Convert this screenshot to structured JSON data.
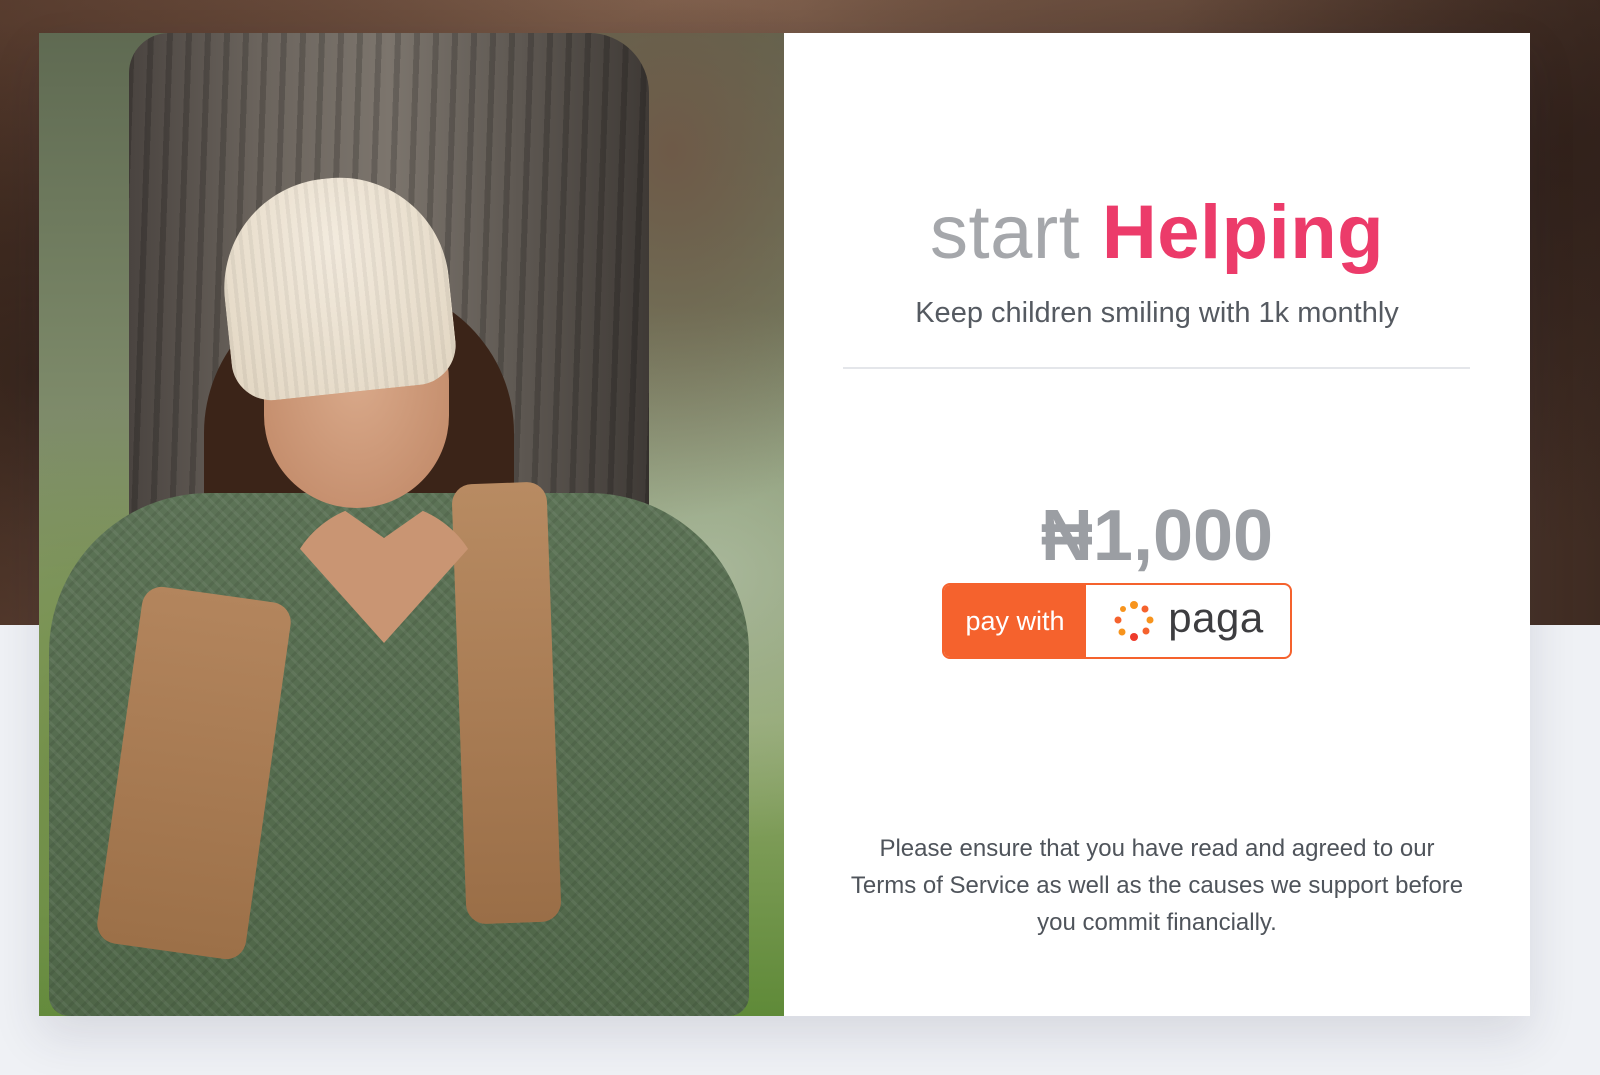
{
  "hero": {
    "image_alt": "Smiling girl in knit hat making heart shape with hands in front of tree"
  },
  "heading": {
    "light_text": "start",
    "bold_text": "Helping"
  },
  "subtitle": "Keep children smiling with 1k monthly",
  "amount": "₦1,000",
  "pay_button": {
    "prefix_label": "pay with",
    "brand_label": "paga",
    "brand_icon": "paga-logo-icon"
  },
  "notice": "Please ensure that you have read and agreed to our Terms of Service as well as the causes we support before you commit financially.",
  "colors": {
    "accent": "#ec3b6a",
    "heading_light": "#a5a7ab",
    "amount": "#9b9ea3",
    "paga_orange": "#f5622d"
  }
}
